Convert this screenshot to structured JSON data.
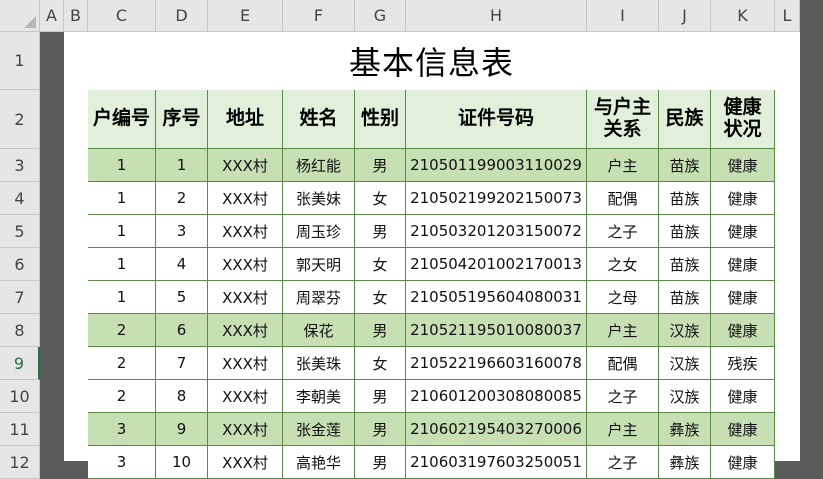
{
  "columns": [
    "A",
    "B",
    "C",
    "D",
    "E",
    "F",
    "G",
    "H",
    "I",
    "J",
    "K",
    "L"
  ],
  "rows": [
    "1",
    "2",
    "3",
    "4",
    "5",
    "6",
    "7",
    "8",
    "9",
    "10",
    "11",
    "12"
  ],
  "selected_row": "9",
  "title": "基本信息表",
  "colors": {
    "header_bg": "#e2efda",
    "household_head_bg": "#c6e0b4",
    "border": "#5b8b48",
    "selected_row_header": "#217346"
  },
  "table": {
    "headers": [
      "户编号",
      "序号",
      "地址",
      "姓名",
      "性别",
      "证件号码",
      "与户主\n关系",
      "民族",
      "健康\n状况"
    ],
    "rows": [
      [
        "1",
        "1",
        "XXX村",
        "杨红能",
        "男",
        "210501199003110029",
        "户主",
        "苗族",
        "健康"
      ],
      [
        "1",
        "2",
        "XXX村",
        "张美妹",
        "女",
        "210502199202150073",
        "配偶",
        "苗族",
        "健康"
      ],
      [
        "1",
        "3",
        "XXX村",
        "周玉珍",
        "男",
        "210503201203150072",
        "之子",
        "苗族",
        "健康"
      ],
      [
        "1",
        "4",
        "XXX村",
        "郭天明",
        "女",
        "210504201002170013",
        "之女",
        "苗族",
        "健康"
      ],
      [
        "1",
        "5",
        "XXX村",
        "周翠芬",
        "女",
        "210505195604080031",
        "之母",
        "苗族",
        "健康"
      ],
      [
        "2",
        "6",
        "XXX村",
        "保花",
        "男",
        "210521195010080037",
        "户主",
        "汉族",
        "健康"
      ],
      [
        "2",
        "7",
        "XXX村",
        "张美珠",
        "女",
        "210522196603160078",
        "配偶",
        "汉族",
        "残疾"
      ],
      [
        "2",
        "8",
        "XXX村",
        "李朝美",
        "男",
        "210601200308080085",
        "之子",
        "汉族",
        "健康"
      ],
      [
        "3",
        "9",
        "XXX村",
        "张金莲",
        "男",
        "210602195403270006",
        "户主",
        "彝族",
        "健康"
      ],
      [
        "3",
        "10",
        "XXX村",
        "高艳华",
        "男",
        "210603197603250051",
        "之子",
        "彝族",
        "健康"
      ]
    ]
  }
}
